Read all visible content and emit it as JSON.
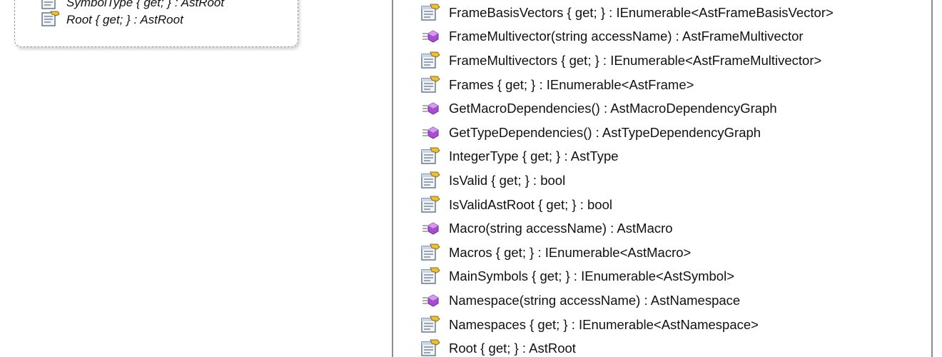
{
  "left_panel": {
    "rows": [
      {
        "icon": "property-icon",
        "text": "SymbolType { get; } : AstRoot"
      },
      {
        "icon": "property-icon",
        "text": "Root { get; } : AstRoot"
      }
    ]
  },
  "right_panel": {
    "members": [
      {
        "icon": "property-icon",
        "text": "FrameBasisVectors { get; } : IEnumerable<AstFrameBasisVector>"
      },
      {
        "icon": "method-icon",
        "text": "FrameMultivector(string accessName) : AstFrameMultivector"
      },
      {
        "icon": "property-icon",
        "text": "FrameMultivectors { get; } : IEnumerable<AstFrameMultivector>"
      },
      {
        "icon": "property-icon",
        "text": "Frames { get; } : IEnumerable<AstFrame>"
      },
      {
        "icon": "method-icon",
        "text": "GetMacroDependencies() : AstMacroDependencyGraph"
      },
      {
        "icon": "method-icon",
        "text": "GetTypeDependencies() : AstTypeDependencyGraph"
      },
      {
        "icon": "property-icon",
        "text": "IntegerType { get; } : AstType"
      },
      {
        "icon": "property-icon",
        "text": "IsValid { get; } : bool"
      },
      {
        "icon": "property-icon",
        "text": "IsValidAstRoot { get; } : bool"
      },
      {
        "icon": "method-icon",
        "text": "Macro(string accessName) : AstMacro"
      },
      {
        "icon": "property-icon",
        "text": "Macros { get; } : IEnumerable<AstMacro>"
      },
      {
        "icon": "property-icon",
        "text": "MainSymbols { get; } : IEnumerable<AstSymbol>"
      },
      {
        "icon": "method-icon",
        "text": "Namespace(string accessName) : AstNamespace"
      },
      {
        "icon": "property-icon",
        "text": "Namespaces { get; } : IEnumerable<AstNamespace>"
      },
      {
        "icon": "property-icon",
        "text": "Root { get; } : AstRoot"
      }
    ]
  },
  "colors": {
    "box_border": "#8c8c8c",
    "method_icon": "#a64dd0",
    "property_icon_paper": "#f4f4f4",
    "property_icon_hand": "#e8c040"
  }
}
